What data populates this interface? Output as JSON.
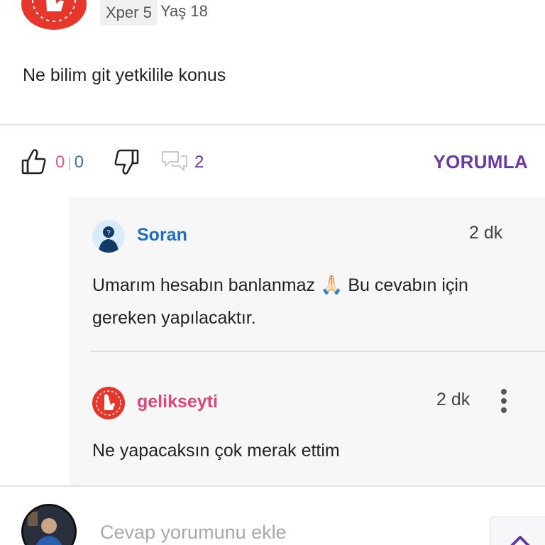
{
  "post": {
    "badge": "Xper 5",
    "age": "Yaş 18",
    "text": "Ne bilim git yetkilile konus"
  },
  "actions": {
    "like_count": "0",
    "separator": "|",
    "dislike_count": "0",
    "comment_count": "2",
    "comment_button": "YORUMLA",
    "like_color": "#e25987",
    "dislike_color": "#3b6fb6",
    "comment_color": "#6b3aa0"
  },
  "comments": [
    {
      "author": "Soran",
      "author_color": "#1f6fbf",
      "time": "2 dk",
      "text_line1": "Umarım hesabın banlanmaz",
      "emoji": "🙏🏻",
      "text_line1b": "Bu cevabın için",
      "text_line2": "gereken yapılacaktır."
    },
    {
      "author": "gelikseyti",
      "author_color": "#e0457b",
      "time": "2 dk",
      "text": "Ne yapacaksın çok merak ettim"
    }
  ],
  "reply": {
    "placeholder": "Cevap yorumunu ekle"
  },
  "icons": [
    "thumbs-up-icon",
    "thumbs-down-icon",
    "comments-icon",
    "more-vertical-icon",
    "chevron-up-icon"
  ]
}
